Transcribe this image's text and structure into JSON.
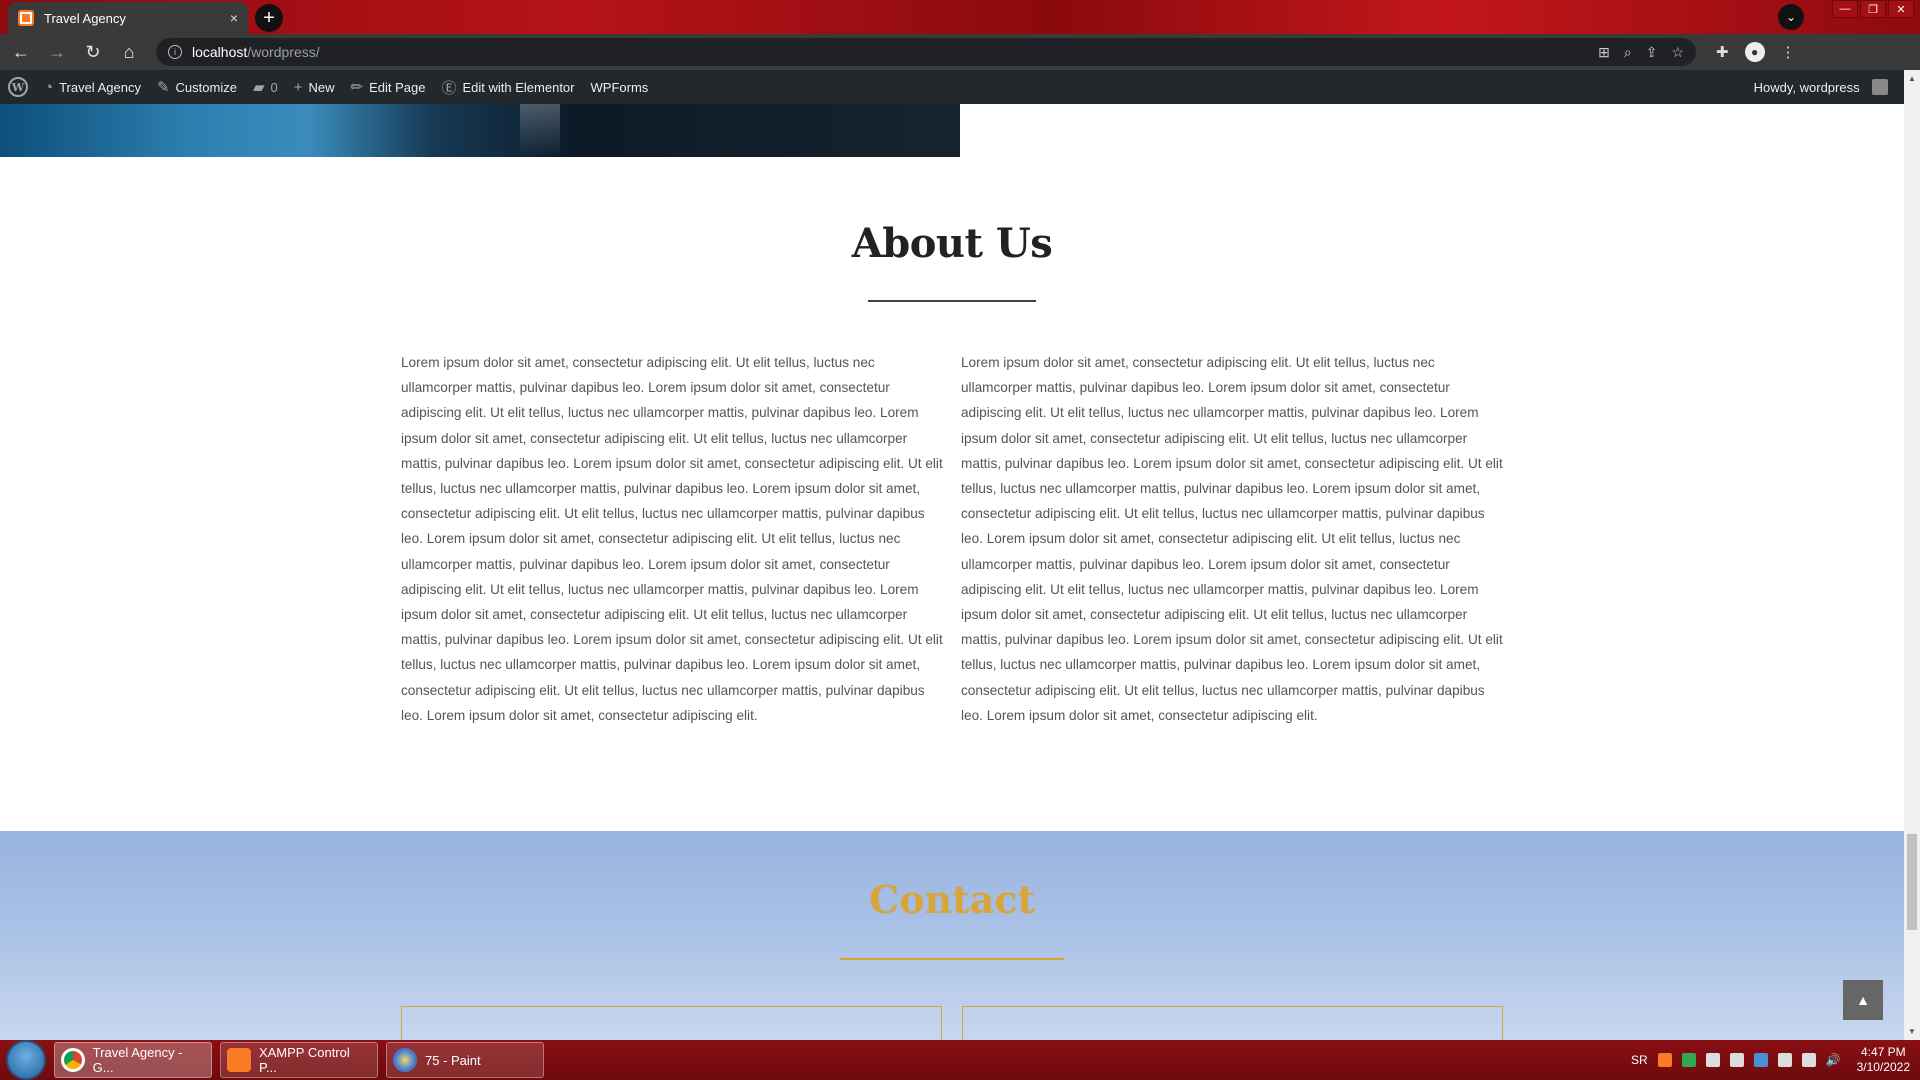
{
  "browser": {
    "tab_title": "Travel Agency",
    "tab_close": "×",
    "new_tab": "+",
    "url_host": "localhost",
    "url_path": "/wordpress/"
  },
  "adminbar": {
    "site_name": "Travel Agency",
    "customize": "Customize",
    "comments_count": "0",
    "new": "New",
    "edit_page": "Edit Page",
    "edit_elementor": "Edit with Elementor",
    "wpforms": "WPForms",
    "howdy": "Howdy, wordpress"
  },
  "about": {
    "title": "About Us",
    "left_text": "Lorem ipsum dolor sit amet, consectetur adipiscing elit. Ut elit tellus, luctus nec ullamcorper mattis, pulvinar dapibus leo. Lorem ipsum dolor sit amet, consectetur adipiscing elit. Ut elit tellus, luctus nec ullamcorper mattis, pulvinar dapibus leo. Lorem ipsum dolor sit amet, consectetur adipiscing elit. Ut elit tellus, luctus nec ullamcorper mattis, pulvinar dapibus leo. Lorem ipsum dolor sit amet, consectetur adipiscing elit. Ut elit tellus, luctus nec ullamcorper mattis, pulvinar dapibus leo. Lorem ipsum dolor sit amet, consectetur adipiscing elit. Ut elit tellus, luctus nec ullamcorper mattis, pulvinar dapibus leo. Lorem ipsum dolor sit amet, consectetur adipiscing elit. Ut elit tellus, luctus nec ullamcorper mattis, pulvinar dapibus leo. Lorem ipsum dolor sit amet, consectetur adipiscing elit. Ut elit tellus, luctus nec ullamcorper mattis, pulvinar dapibus leo. Lorem ipsum dolor sit amet, consectetur adipiscing elit. Ut elit tellus, luctus nec ullamcorper mattis, pulvinar dapibus leo. Lorem ipsum dolor sit amet, consectetur adipiscing elit. Ut elit tellus, luctus nec ullamcorper mattis, pulvinar dapibus leo. Lorem ipsum dolor sit amet, consectetur adipiscing elit. Ut elit tellus, luctus nec ullamcorper mattis, pulvinar dapibus leo. Lorem ipsum dolor sit amet, consectetur adipiscing elit.",
    "right_text": "Lorem ipsum dolor sit amet, consectetur adipiscing elit. Ut elit tellus, luctus nec ullamcorper mattis, pulvinar dapibus leo. Lorem ipsum dolor sit amet, consectetur adipiscing elit. Ut elit tellus, luctus nec ullamcorper mattis, pulvinar dapibus leo. Lorem ipsum dolor sit amet, consectetur adipiscing elit. Ut elit tellus, luctus nec ullamcorper mattis, pulvinar dapibus leo. Lorem ipsum dolor sit amet, consectetur adipiscing elit. Ut elit tellus, luctus nec ullamcorper mattis, pulvinar dapibus leo. Lorem ipsum dolor sit amet, consectetur adipiscing elit. Ut elit tellus, luctus nec ullamcorper mattis, pulvinar dapibus leo. Lorem ipsum dolor sit amet, consectetur adipiscing elit. Ut elit tellus, luctus nec ullamcorper mattis, pulvinar dapibus leo. Lorem ipsum dolor sit amet, consectetur adipiscing elit. Ut elit tellus, luctus nec ullamcorper mattis, pulvinar dapibus leo. Lorem ipsum dolor sit amet, consectetur adipiscing elit. Ut elit tellus, luctus nec ullamcorper mattis, pulvinar dapibus leo. Lorem ipsum dolor sit amet, consectetur adipiscing elit. Ut elit tellus, luctus nec ullamcorper mattis, pulvinar dapibus leo. Lorem ipsum dolor sit amet, consectetur adipiscing elit. Ut elit tellus, luctus nec ullamcorper mattis, pulvinar dapibus leo. Lorem ipsum dolor sit amet, consectetur adipiscing elit."
  },
  "contact": {
    "title": "Contact"
  },
  "taskbar": {
    "tasks": [
      "Travel Agency - G...",
      "XAMPP Control P...",
      "75 - Paint"
    ],
    "lang": "SR",
    "time": "4:47 PM",
    "date": "3/10/2022"
  },
  "colors": {
    "accent_gold": "#d9a43a",
    "adminbar_bg": "#23282d",
    "taskbar_red": "#8a1014"
  }
}
